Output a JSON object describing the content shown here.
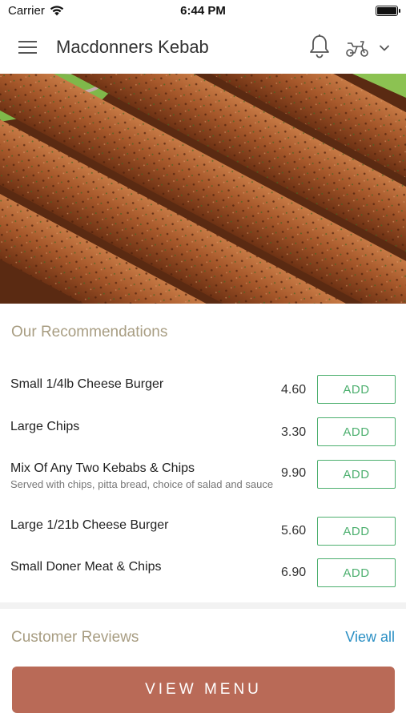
{
  "status_bar": {
    "carrier": "Carrier",
    "time": "6:44 PM"
  },
  "header": {
    "title": "Macdonners Kebab",
    "icons": [
      "menu-icon",
      "bell-icon",
      "scooter-icon",
      "chevron-down-icon"
    ]
  },
  "recommendations": {
    "title": "Our Recommendations",
    "items": [
      {
        "name": "Small 1/4lb Cheese Burger",
        "description": "",
        "price": "4.60",
        "button": "ADD"
      },
      {
        "name": "Large Chips",
        "description": "",
        "price": "3.30",
        "button": "ADD"
      },
      {
        "name": "Mix Of Any Two Kebabs & Chips",
        "description": "Served with chips, pitta bread, choice of salad and sauce",
        "price": "9.90",
        "button": "ADD"
      },
      {
        "name": "Large 1/21b Cheese Burger",
        "description": "",
        "price": "5.60",
        "button": "ADD"
      },
      {
        "name": "Small Doner Meat & Chips",
        "description": "",
        "price": "6.90",
        "button": "ADD"
      }
    ]
  },
  "reviews": {
    "title": "Customer Reviews",
    "view_all": "View all"
  },
  "footer": {
    "view_menu": "VIEW MENU"
  },
  "colors": {
    "accent_green": "#4caf6e",
    "section_title": "#a89d82",
    "link_blue": "#2a8fc4",
    "primary_button": "#b96a57"
  }
}
